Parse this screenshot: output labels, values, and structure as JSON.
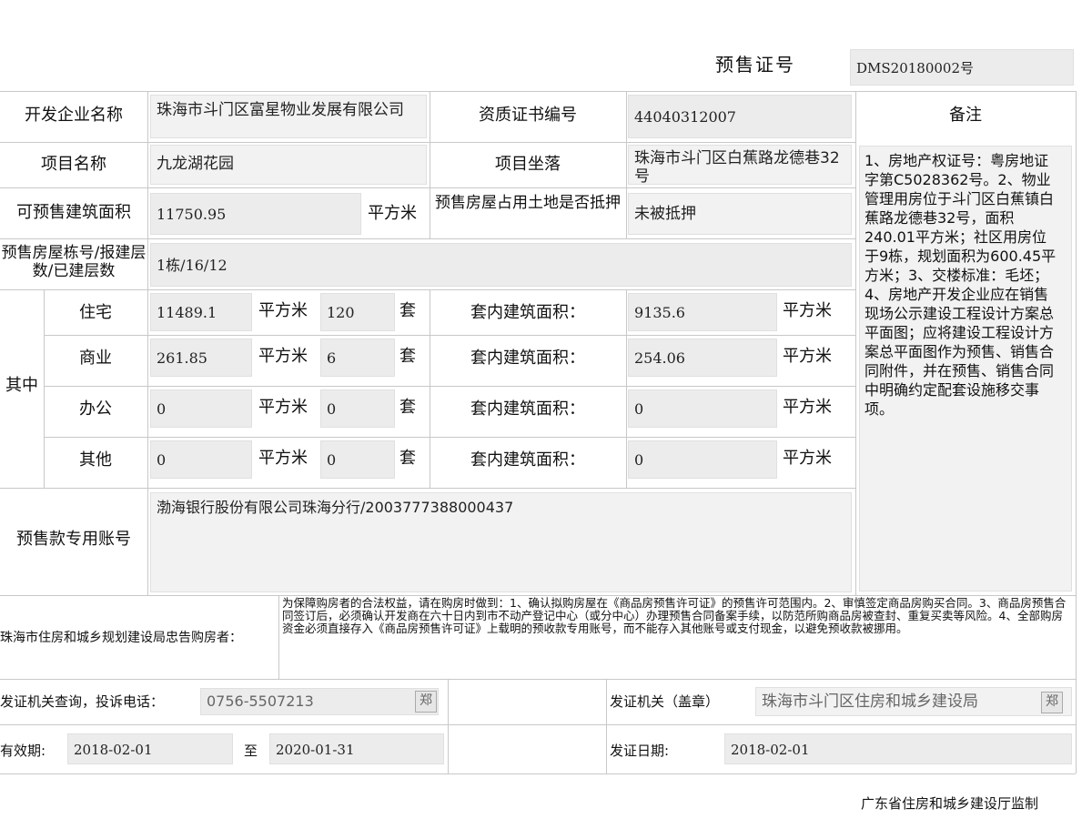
{
  "header": {
    "presale_no_label": "预售证号",
    "presale_no": "DMS20180002号"
  },
  "row1": {
    "developer_label": "开发企业名称",
    "developer": "珠海市斗门区富星物业发展有限公司",
    "cert_label": "资质证书编号",
    "cert_no": "44040312007",
    "remarks_label": "备注"
  },
  "row2": {
    "project_label": "项目名称",
    "project": "九龙湖花园",
    "location_label": "项目坐落",
    "location": "珠海市斗门区白蕉路龙德巷32号"
  },
  "row3": {
    "area_label": "可预售建筑面积",
    "area": "11750.95",
    "area_unit": "平方米",
    "mortgage_label": "预售房屋占用土地是否抵押",
    "mortgage": "未被抵押"
  },
  "row4": {
    "building_label": "预售房屋栋号/报建层数/已建层数",
    "building": "1栋/16/12"
  },
  "breakdown": {
    "group_label": "其中",
    "sqm": "平方米",
    "set": "套",
    "inner_label": "套内建筑面积：",
    "rows": [
      {
        "type": "住宅",
        "area": "11489.1",
        "count": "120",
        "inner": "9135.6"
      },
      {
        "type": "商业",
        "area": "261.85",
        "count": "6",
        "inner": "254.06"
      },
      {
        "type": "办公",
        "area": "0",
        "count": "0",
        "inner": "0"
      },
      {
        "type": "其他",
        "area": "0",
        "count": "0",
        "inner": "0"
      }
    ]
  },
  "account": {
    "label": "预售款专用账号",
    "value": "渤海银行股份有限公司珠海分行/2003777388000437"
  },
  "remarks": "1、房地产权证号：粤房地证字第C5028362号。2、物业管理用房位于斗门区白蕉镇白蕉路龙德巷32号，面积240.01平方米；社区用房位于9栋，规划面积为600.45平方米；3、交楼标准：毛坯；4、房地产开发企业应在销售现场公示建设工程设计方案总平面图；应将建设工程设计方案总平面图作为预售、销售合同附件，并在预售、销售合同中明确约定配套设施移交事项。",
  "notice": {
    "label": "珠海市住房和城乡规划建设局忠告购房者：",
    "text": "为保障购房者的合法权益，请在购房时做到：1、确认拟购房屋在《商品房预售许可证》的预售许可范围内。2、审慎签定商品房购买合同。3、商品房预售合同签订后，必须确认开发商在六十日内到市不动产登记中心（或分中心）办理预售合同备案手续，以防范所购商品房被查封、重复买卖等风险。4、全部购房资金必须直接存入《商品房预售许可证》上载明的预收款专用账号，而不能存入其他账号或支付现金，以避免预收款被挪用。"
  },
  "footer": {
    "phone_label": "发证机关查询，投诉电话：",
    "phone": "0756-5507213",
    "chip": "郑",
    "issuer_label": "发证机关（盖章）",
    "issuer": "珠海市斗门区住房和城乡建设局",
    "validity_label": "有效期:",
    "valid_from": "2018-02-01",
    "to": "至",
    "valid_to": "2020-01-31",
    "issue_date_label": "发证日期:",
    "issue_date": "2018-02-01"
  },
  "supervision": "广东省住房和城乡建设厅监制"
}
